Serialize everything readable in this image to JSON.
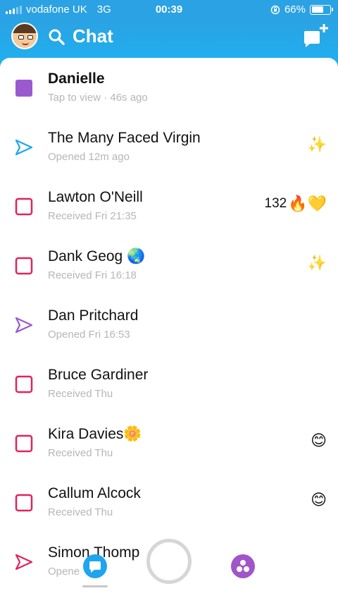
{
  "status_bar": {
    "carrier": "vodafone UK",
    "network": "3G",
    "time": "00:39",
    "battery_percent": "66%",
    "battery_level": 0.66
  },
  "header": {
    "title": "Chat"
  },
  "chats": [
    {
      "name": "Danielle",
      "status": "Tap to view · 46s ago",
      "icon": "filled-square-icon",
      "icon_color": "#9b59d0",
      "bold": true,
      "right_text": "",
      "right_emoji": ""
    },
    {
      "name": "The Many Faced Virgin",
      "status": "Opened 12m ago",
      "icon": "sent-arrow-icon",
      "icon_color": "#1fa4ef",
      "bold": false,
      "right_text": "",
      "right_emoji": "✨"
    },
    {
      "name": "Lawton O'Neill",
      "status": "Received Fri 21:35",
      "icon": "outline-square-icon",
      "icon_color": "#e0245e",
      "bold": false,
      "right_text": "132",
      "right_emoji": "🔥💛"
    },
    {
      "name": "Dank Geog 🌏",
      "status": "Received Fri 16:18",
      "icon": "outline-square-icon",
      "icon_color": "#e0245e",
      "bold": false,
      "right_text": "",
      "right_emoji": "✨"
    },
    {
      "name": "Dan Pritchard",
      "status": "Opened Fri 16:53",
      "icon": "sent-arrow-icon",
      "icon_color": "#9b59d0",
      "bold": false,
      "right_text": "",
      "right_emoji": ""
    },
    {
      "name": "Bruce Gardiner",
      "status": "Received Thu",
      "icon": "outline-square-icon",
      "icon_color": "#e0245e",
      "bold": false,
      "right_text": "",
      "right_emoji": ""
    },
    {
      "name": "Kira Davies🌼",
      "status": "Received Thu",
      "icon": "outline-square-icon",
      "icon_color": "#e0245e",
      "bold": false,
      "right_text": "",
      "right_emoji": "😊"
    },
    {
      "name": "Callum Alcock",
      "status": "Received Thu",
      "icon": "outline-square-icon",
      "icon_color": "#e0245e",
      "bold": false,
      "right_text": "",
      "right_emoji": "😊"
    },
    {
      "name": "Simon Thomp",
      "status": "Opene",
      "icon": "sent-arrow-icon",
      "icon_color": "#e0245e",
      "bold": false,
      "right_text": "",
      "right_emoji": ""
    }
  ],
  "colors": {
    "brand_blue": "#1fa4ef",
    "received_red": "#e0245e",
    "purple": "#9b59d0"
  }
}
